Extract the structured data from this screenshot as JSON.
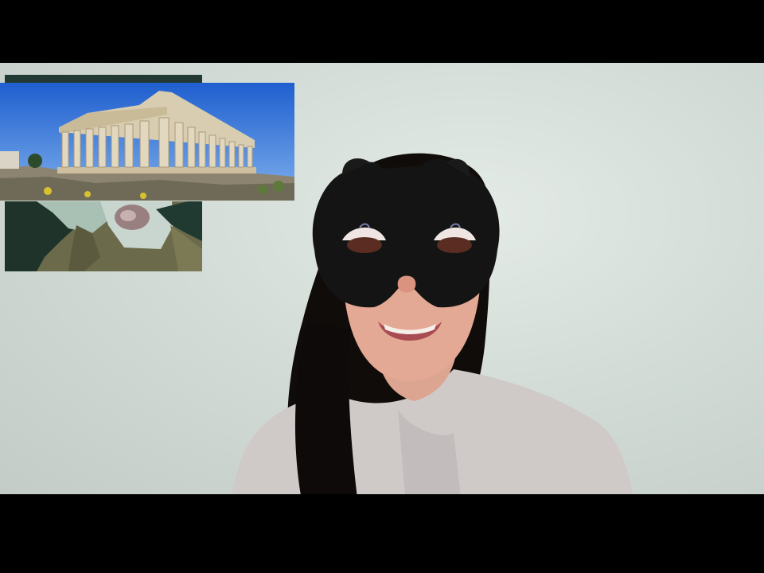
{
  "scene": {
    "subject": "masked-woman",
    "inset_top": "parthenon-photo",
    "inset_bottom": "cartoon-still"
  },
  "colors": {
    "letterbox": "#000000",
    "wall": "#d6ded9",
    "sky": "#2f6fd6",
    "mask": "#141414",
    "hair": "#0e0b0a",
    "shirt": "#cfc9c8",
    "skin": "#e3a994"
  }
}
